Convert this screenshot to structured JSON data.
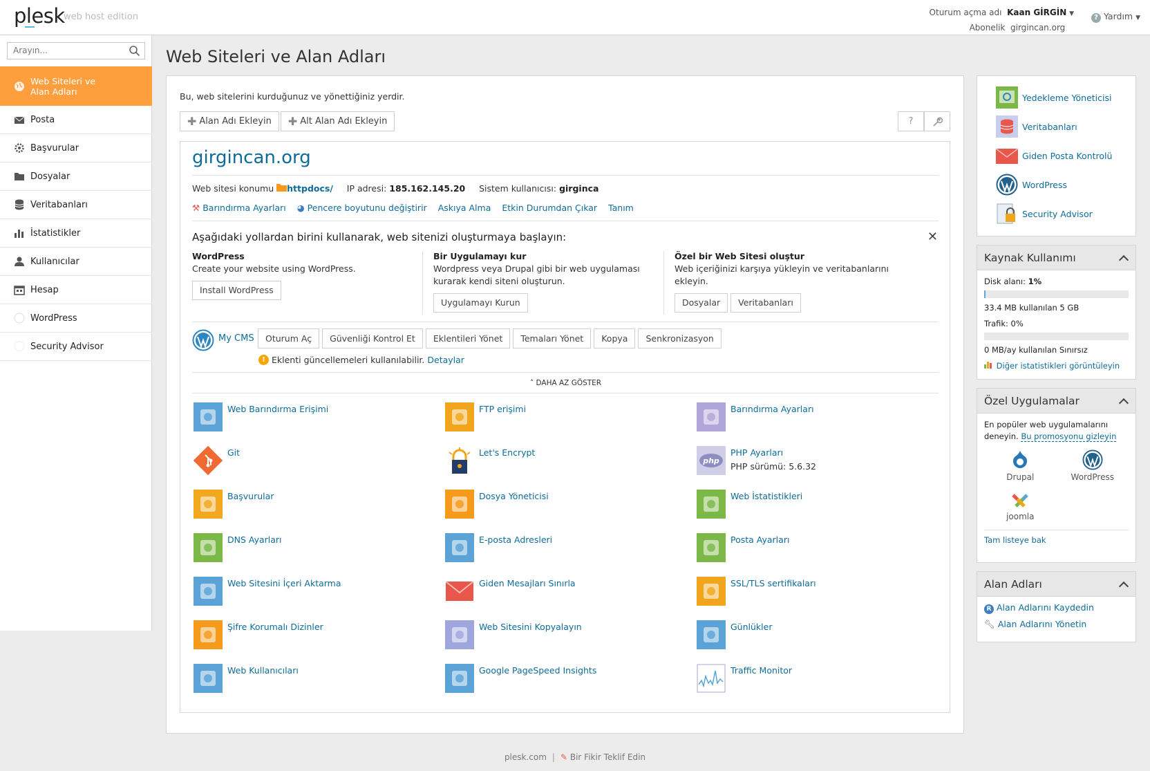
{
  "header": {
    "logo_text": "plesk",
    "edition": "web host edition",
    "login_label": "Oturum açma adı",
    "login_name": "Kaan GİRGİN",
    "subscription_label": "Abonelik",
    "subscription_value": "girgincan.org",
    "help_label": "Yardım"
  },
  "sidebar": {
    "search_placeholder": "Arayın...",
    "items": [
      {
        "label": "Web Siteleri ve Alan Adları",
        "icon": "globe-icon",
        "active": true
      },
      {
        "label": "Posta",
        "icon": "mail-icon"
      },
      {
        "label": "Başvurular",
        "icon": "gear-icon"
      },
      {
        "label": "Dosyalar",
        "icon": "folder-icon"
      },
      {
        "label": "Veritabanları",
        "icon": "database-icon"
      },
      {
        "label": "İstatistikler",
        "icon": "bar-chart-icon"
      },
      {
        "label": "Kullanıcılar",
        "icon": "user-icon"
      },
      {
        "label": "Hesap",
        "icon": "calendar-icon"
      },
      {
        "label": "WordPress",
        "icon": "wordpress-icon"
      },
      {
        "label": "Security Advisor",
        "icon": "shield-icon"
      }
    ]
  },
  "page": {
    "title": "Web Siteleri ve Alan Adları",
    "intro": "Bu, web sitelerini kurduğunuz ve yönettiğiniz yerdir.",
    "add_domain": "Alan Adı Ekleyin",
    "add_subdomain": "Alt Alan Adı Ekleyin",
    "help_btn": "?"
  },
  "domain": {
    "name": "girgincan.org",
    "location_label": "Web sitesi konumu",
    "location_value": "httpdocs/",
    "ip_label": "IP adresi:",
    "ip_value": "185.162.145.20",
    "sysuser_label": "Sistem kullanıcısı:",
    "sysuser_value": "girginca",
    "links": [
      "Barındırma Ayarları",
      "Pencere boyutunu değiştirir",
      "Askıya Alma",
      "Etkin Durumdan Çıkar",
      "Tanım"
    ]
  },
  "getting_started": {
    "title": "Aşağıdaki yollardan birini kullanarak, web sitenizi oluşturmaya başlayın:",
    "columns": [
      {
        "title": "WordPress",
        "desc": "Create your website using WordPress.",
        "buttons": [
          "Install WordPress"
        ]
      },
      {
        "title": "Bir Uygulamayı kur",
        "desc": "Wordpress veya Drupal gibi bir web uygulaması kurarak kendi siteni oluşturun.",
        "buttons": [
          "Uygulamayı Kurun"
        ]
      },
      {
        "title": "Özel bir Web Sitesi oluştur",
        "desc": "Web içeriğinizi karşıya yükleyin ve veritabanlarını ekleyin.",
        "buttons": [
          "Dosyalar",
          "Veritabanları"
        ]
      }
    ]
  },
  "wp": {
    "name": "My CMS",
    "buttons": [
      "Oturum Aç",
      "Güvenliği Kontrol Et",
      "Eklentileri Yönet",
      "Temaları Yönet",
      "Kopya",
      "Senkronizasyon"
    ],
    "warning": "Eklenti güncellemeleri kullanılabilir.",
    "warning_link": "Detaylar"
  },
  "show_less": "DAHA AZ GÖSTER",
  "tools": [
    {
      "label": "Web Barındırma Erişimi",
      "icon": "hosting-access-icon",
      "color": "#5ba3d6"
    },
    {
      "label": "FTP erişimi",
      "icon": "ftp-icon",
      "color": "#f1a51d"
    },
    {
      "label": "Barındırma Ayarları",
      "icon": "hosting-settings-icon",
      "color": "#b0a5d8"
    },
    {
      "label": "Git",
      "icon": "git-icon",
      "color": "#f06a32"
    },
    {
      "label": "Let's Encrypt",
      "icon": "lets-encrypt-icon",
      "color": "#223d6a"
    },
    {
      "label": "PHP Ayarları",
      "sub": "PHP sürümü: 5.6.32",
      "icon": "php-icon",
      "color": "#8d8dbf"
    },
    {
      "label": "Başvurular",
      "icon": "applications-icon",
      "color": "#f2a81e"
    },
    {
      "label": "Dosya Yöneticisi",
      "icon": "file-manager-icon",
      "color": "#f59a1b"
    },
    {
      "label": "Web İstatistikleri",
      "icon": "web-stats-icon",
      "color": "#7cb848"
    },
    {
      "label": "DNS Ayarları",
      "icon": "dns-icon",
      "color": "#7cb848"
    },
    {
      "label": "E-posta Adresleri",
      "icon": "email-addresses-icon",
      "color": "#5ba3d6"
    },
    {
      "label": "Posta Ayarları",
      "icon": "mail-settings-icon",
      "color": "#7cb848"
    },
    {
      "label": "Web Sitesini İçeri Aktarma",
      "icon": "website-import-icon",
      "color": "#5ba3d6"
    },
    {
      "label": "Giden Mesajları Sınırla",
      "icon": "outgoing-mail-icon",
      "color": "#e8574b"
    },
    {
      "label": "SSL/TLS sertifikaları",
      "icon": "ssl-icon",
      "color": "#f1a51d"
    },
    {
      "label": "Şifre Korumalı Dizinler",
      "icon": "protected-dirs-icon",
      "color": "#f59a1b"
    },
    {
      "label": "Web Sitesini Kopyalayın",
      "icon": "website-copy-icon",
      "color": "#9fa6dd"
    },
    {
      "label": "Günlükler",
      "icon": "logs-icon",
      "color": "#5ba3d6"
    },
    {
      "label": "Web Kullanıcıları",
      "icon": "web-users-icon",
      "color": "#5ba3d6"
    },
    {
      "label": "Google PageSpeed Insights",
      "icon": "pagespeed-icon",
      "color": "#5ba3d6"
    },
    {
      "label": "Traffic Monitor",
      "icon": "traffic-monitor-icon",
      "color": "#5ba3d6"
    }
  ],
  "quick_links": [
    {
      "label": "Yedekleme Yöneticisi",
      "icon": "backup-icon"
    },
    {
      "label": "Veritabanları",
      "icon": "database-icon"
    },
    {
      "label": "Giden Posta Kontrolü",
      "icon": "outgoing-mail-icon"
    },
    {
      "label": "WordPress",
      "icon": "wordpress-icon"
    },
    {
      "label": "Security Advisor",
      "icon": "security-advisor-icon"
    }
  ],
  "resource": {
    "title": "Kaynak Kullanımı",
    "disk_label": "Disk alanı:",
    "disk_pct": "1%",
    "disk_used": "33.4 MB kullanılan 5 GB",
    "traffic_label": "Trafik:",
    "traffic_pct": "0%",
    "traffic_used": "0 MB/ay kullanılan Sınırsız",
    "more_stats": "Diğer istatistikleri görüntüleyin"
  },
  "apps": {
    "title": "Özel Uygulamalar",
    "desc": "En popüler web uygulamalarını deneyin.",
    "promo_link": "Bu promosyonu gizleyin",
    "items": [
      "Drupal",
      "WordPress",
      "joomla"
    ],
    "full_list": "Tam listeye bak"
  },
  "domains_panel": {
    "title": "Alan Adları",
    "register": "Alan Adlarını Kaydedin",
    "manage": "Alan Adlarını Yönetin"
  },
  "footer": {
    "site": "plesk.com",
    "sep": "|",
    "suggest": "Bir Fikir Teklif Edin"
  }
}
